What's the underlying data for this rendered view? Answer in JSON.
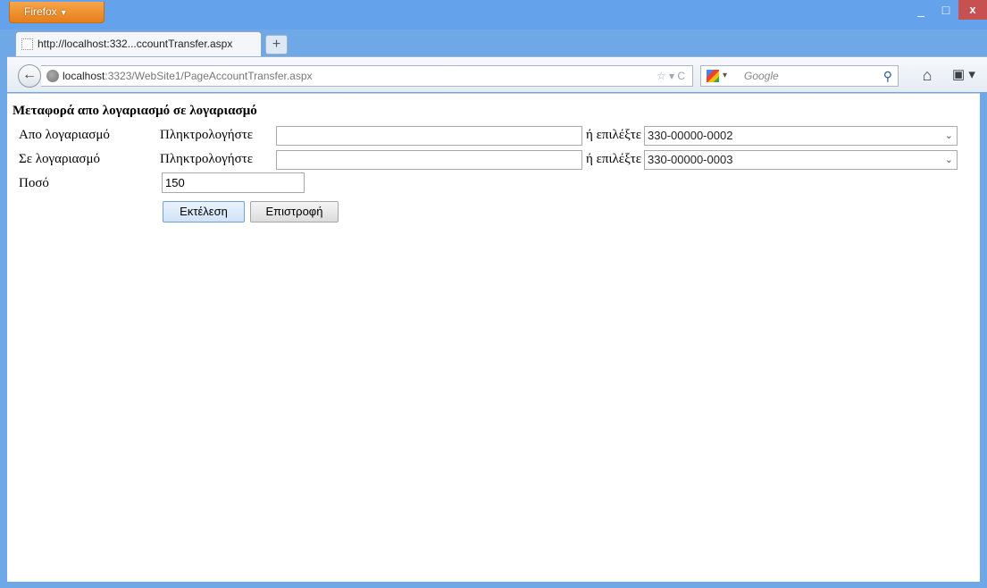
{
  "browser": {
    "menu_button_label": "Firefox",
    "window_controls": {
      "minimize": "_",
      "maximize": "□",
      "close": "x"
    },
    "tab": {
      "title": "http://localhost:332...ccountTransfer.aspx"
    },
    "new_tab": "+",
    "url": {
      "host": "localhost",
      "rest": ":3323/WebSite1/PageAccountTransfer.aspx"
    },
    "search": {
      "engine": "Google",
      "placeholder": "Google"
    }
  },
  "form": {
    "title": "Μεταφορά απο λογαριασμό σε λογαριασμό",
    "from": {
      "label": "Απο λογαριασμό",
      "type_label": "Πληκτρολογήστε",
      "input_value": "",
      "or_label": "ή επιλέξτε",
      "selected_account": "330-00000-0002"
    },
    "to": {
      "label": "Σε λογαριασμό",
      "type_label": "Πληκτρολογήστε",
      "input_value": "",
      "or_label": "ή επιλέξτε",
      "selected_account": "330-00000-0003"
    },
    "amount": {
      "label": "Ποσό",
      "value": "150"
    },
    "buttons": {
      "execute": "Εκτέλεση",
      "back": "Επιστροφή"
    }
  }
}
